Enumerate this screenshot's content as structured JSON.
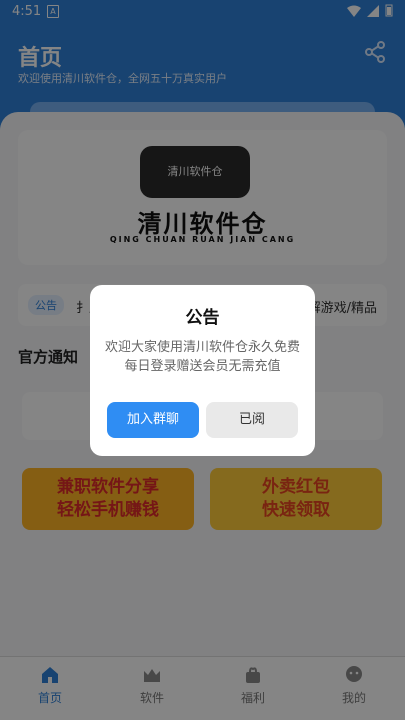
{
  "status": {
    "time": "4:51",
    "notification": "A"
  },
  "header": {
    "title": "首页",
    "subtitle": "欢迎使用清川软件仓，全网五十万真实用户"
  },
  "banner": {
    "logo_text": "清川软件仓",
    "name": "清川软件仓",
    "pinyin": "QING CHUAN RUAN JIAN CANG"
  },
  "notice": {
    "tag": "公告",
    "left_text": "扌川",
    "right_text": "破解游戏/精品"
  },
  "section": {
    "title": "官方通知"
  },
  "promos": [
    {
      "line1": "兼职软件分享",
      "line2": "轻松手机赚钱"
    },
    {
      "line1": "外卖红包",
      "line2": "快速领取"
    }
  ],
  "tabs": [
    {
      "label": "首页",
      "icon": "home-icon"
    },
    {
      "label": "软件",
      "icon": "crown-icon"
    },
    {
      "label": "福利",
      "icon": "gift-icon"
    },
    {
      "label": "我的",
      "icon": "profile-icon"
    }
  ],
  "dialog": {
    "title": "公告",
    "body_line1": "欢迎大家使用清川软件仓永久免费",
    "body_line2": "每日登录赠送会员无需充值",
    "join_label": "加入群聊",
    "read_label": "已阅"
  },
  "colors": {
    "accent": "#2f80d8",
    "dialog_button": "#2f8df3"
  }
}
